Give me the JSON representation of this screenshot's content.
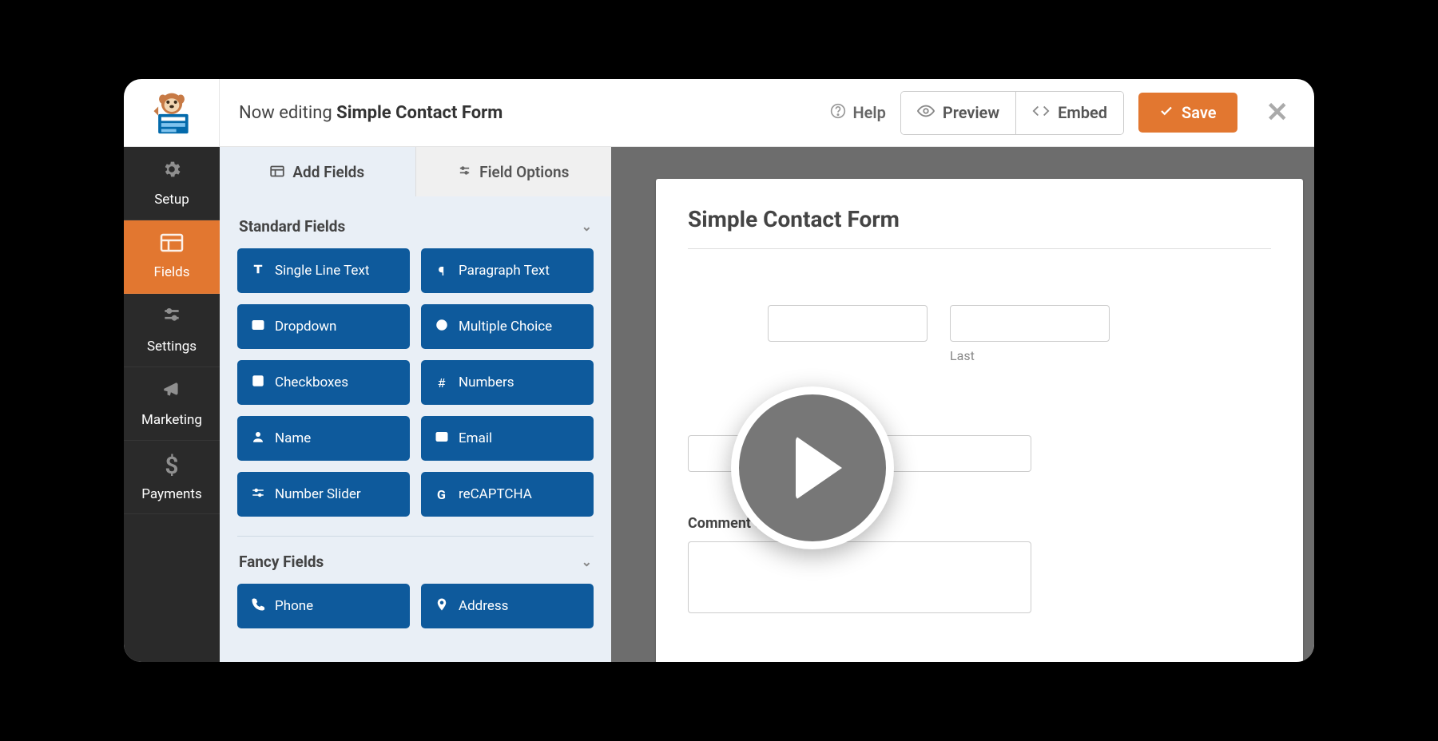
{
  "header": {
    "editing_prefix": "Now editing",
    "form_name": "Simple Contact Form",
    "help_label": "Help",
    "preview_label": "Preview",
    "embed_label": "Embed",
    "save_label": "Save"
  },
  "sidebar": {
    "items": [
      {
        "label": "Setup",
        "icon": "gear"
      },
      {
        "label": "Fields",
        "icon": "layout"
      },
      {
        "label": "Settings",
        "icon": "sliders"
      },
      {
        "label": "Marketing",
        "icon": "bullhorn"
      },
      {
        "label": "Payments",
        "icon": "dollar"
      }
    ]
  },
  "panel": {
    "tab_add": "Add Fields",
    "tab_options": "Field Options",
    "standard_heading": "Standard Fields",
    "fancy_heading": "Fancy Fields",
    "standard_fields": [
      {
        "label": "Single Line Text",
        "icon": "text"
      },
      {
        "label": "Paragraph Text",
        "icon": "paragraph"
      },
      {
        "label": "Dropdown",
        "icon": "dropdown"
      },
      {
        "label": "Multiple Choice",
        "icon": "radio"
      },
      {
        "label": "Checkboxes",
        "icon": "checkbox"
      },
      {
        "label": "Numbers",
        "icon": "hash"
      },
      {
        "label": "Name",
        "icon": "user"
      },
      {
        "label": "Email",
        "icon": "envelope"
      },
      {
        "label": "Number Slider",
        "icon": "sliders"
      },
      {
        "label": "reCAPTCHA",
        "icon": "google"
      }
    ],
    "fancy_fields": [
      {
        "label": "Phone",
        "icon": "phone"
      },
      {
        "label": "Address",
        "icon": "pin"
      }
    ]
  },
  "form": {
    "title": "Simple Contact Form",
    "name_last_label": "Last",
    "comment_label": "Comment or Message",
    "required_mark": "*"
  },
  "colors": {
    "accent": "#e27730",
    "primary_field": "#0e5a9c",
    "sidebar_bg": "#2a2a2a"
  }
}
